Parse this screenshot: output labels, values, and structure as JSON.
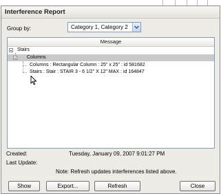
{
  "dialog": {
    "title": "Interference Report",
    "group_by_label": "Group by:",
    "group_by_value": "Category 1, Category 2",
    "column_header": "Message",
    "tree": {
      "root": "Stairs",
      "child": "Columns",
      "items": [
        "Columns : Rectangular Column : 25\" x 25\" : id 581682",
        "Stairs : Stair : STAIR 3 - 6 1/2\" X 12\" MAX : id 164847"
      ]
    },
    "created_label": "Created:",
    "created_value": "Tuesday, January 09, 2007 9:01:27 PM",
    "last_update_label": "Last Update:",
    "note": "Note: Refresh updates interferences listed above.",
    "buttons": {
      "show": "Show",
      "export": "Export...",
      "refresh": "Refresh",
      "close": "Close"
    }
  },
  "icons": [
    "chevron-down-icon",
    "collapse-icon",
    "mouse-cursor-icon"
  ],
  "colors": {
    "dialog_bg": "#ecebe6",
    "selected_row": "#c9c9c9",
    "field_border": "#7f9db9"
  }
}
